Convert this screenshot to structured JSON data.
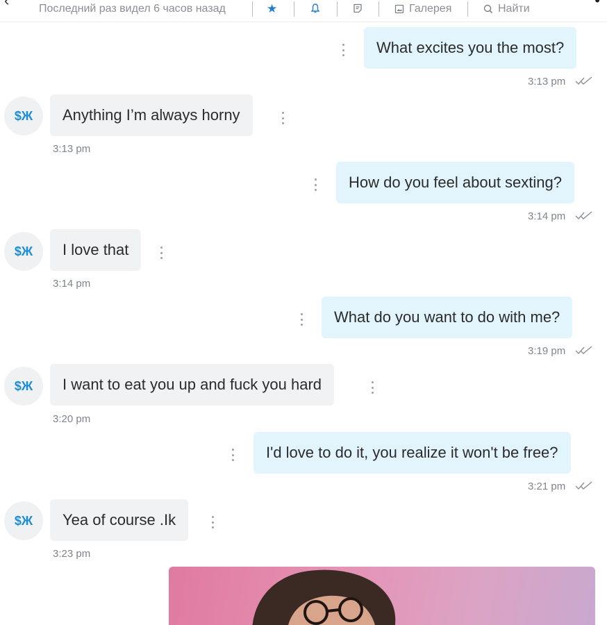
{
  "header": {
    "last_seen": "Последний раз видел 6 часов назад",
    "gallery_label": "Галерея",
    "search_label": "Найти"
  },
  "contact": {
    "avatar_text": "$Ж"
  },
  "messages": [
    {
      "dir": "out",
      "text": "What excites you the most?",
      "time": "3:13 pm"
    },
    {
      "dir": "in",
      "text": "Anything I’m always horny",
      "time": "3:13 pm"
    },
    {
      "dir": "out",
      "text": "How do you feel about sexting?",
      "time": "3:14 pm"
    },
    {
      "dir": "in",
      "text": "I love that",
      "time": "3:14 pm"
    },
    {
      "dir": "out",
      "text": "What do you want to do with me?",
      "time": "3:19 pm"
    },
    {
      "dir": "in",
      "text": "I want to eat you up and fuck you hard",
      "time": "3:20 pm"
    },
    {
      "dir": "out",
      "text": "I'd love to do it, you realize it won't be free?",
      "time": "3:21 pm"
    },
    {
      "dir": "in",
      "text": "Yea of course .Ik",
      "time": "3:23 pm"
    }
  ],
  "colors": {
    "accent": "#1e7fd0",
    "outgoing_bubble": "#e2f4fc",
    "incoming_bubble": "#f1f2f3"
  }
}
